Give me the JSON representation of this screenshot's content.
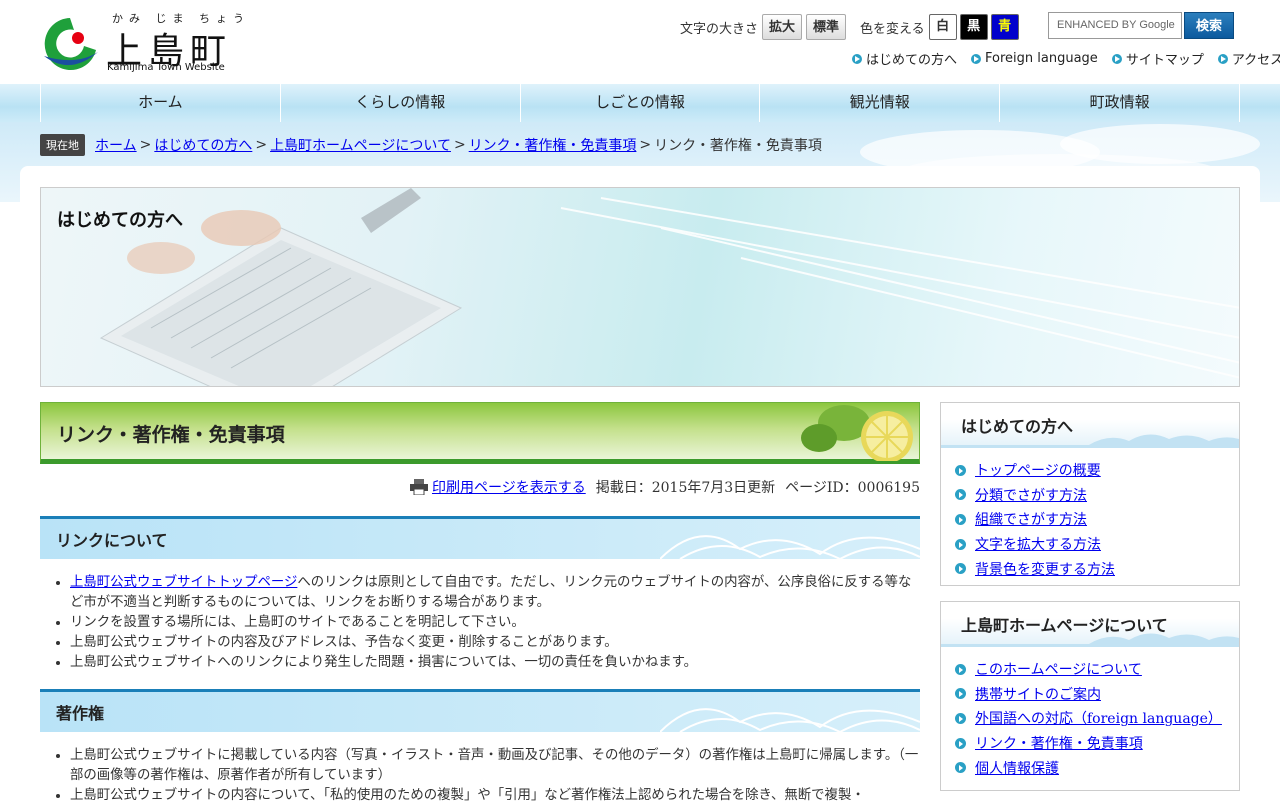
{
  "header": {
    "logo_ruby": "かみ じま ちょう",
    "logo_name": "上島町",
    "logo_sub": "Kamijima Town Website",
    "font_size_label": "文字の大きさ",
    "font_enlarge": "拡大",
    "font_standard": "標準",
    "color_label": "色を変える",
    "color_white": "白",
    "color_black": "黒",
    "color_blue": "青",
    "search_placeholder": "ENHANCED BY Google",
    "search_button": "検索",
    "sublinks": [
      "はじめての方へ",
      "Foreign language",
      "サイトマップ",
      "アクセス"
    ]
  },
  "nav": [
    "ホーム",
    "くらしの情報",
    "しごとの情報",
    "観光情報",
    "町政情報"
  ],
  "breadcrumb": {
    "here_label": "現在地",
    "links": [
      "ホーム",
      "はじめての方へ",
      "上島町ホームページについて",
      "リンク・著作権・免責事項"
    ],
    "current": "リンク・著作権・免責事項",
    "sep": ">"
  },
  "hero": {
    "title": "はじめての方へ"
  },
  "content": {
    "title": "リンク・著作権・免責事項",
    "print_link": "印刷用ページを表示する",
    "published": "掲載日：2015年7月3日更新",
    "page_id": "ページID：0006195",
    "sections": [
      {
        "heading": "リンクについて",
        "items": [
          {
            "link": "上島町公式ウェブサイトトップページ",
            "text": "へのリンクは原則として自由です。ただし、リンク元のウェブサイトの内容が、公序良俗に反する等など市が不適当と判断するものについては、リンクをお断りする場合があります。"
          },
          {
            "link": "",
            "text": "リンクを設置する場所には、上島町のサイトであることを明記して下さい。"
          },
          {
            "link": "",
            "text": "上島町公式ウェブサイトの内容及びアドレスは、予告なく変更・削除することがあります。"
          },
          {
            "link": "",
            "text": "上島町公式ウェブサイトへのリンクにより発生した問題・損害については、一切の責任を負いかねます。"
          }
        ]
      },
      {
        "heading": "著作権",
        "items": [
          {
            "link": "",
            "text": "上島町公式ウェブサイトに掲載している内容（写真・イラスト・音声・動画及び記事、その他のデータ）の著作権は上島町に帰属します。（一部の画像等の著作権は、原著作者が所有しています）"
          },
          {
            "link": "",
            "text": "上島町公式ウェブサイトの内容について、「私的使用のための複製」や「引用」など著作権法上認められた場合を除き、無断で複製・"
          }
        ]
      }
    ]
  },
  "sidebar": [
    {
      "heading": "はじめての方へ",
      "items": [
        "トップページの概要",
        "分類でさがす方法",
        "組織でさがす方法",
        "文字を拡大する方法",
        "背景色を変更する方法"
      ]
    },
    {
      "heading": "上島町ホームページについて",
      "items": [
        "このホームページについて",
        "携帯サイトのご案内",
        "外国語への対応（foreign language）",
        "リンク・著作権・免責事項",
        "個人情報保護"
      ]
    }
  ],
  "colors": {
    "accent_blue": "#1a7fb8",
    "accent_green": "#3b9a2c",
    "bullet": "#2aa0c5"
  }
}
